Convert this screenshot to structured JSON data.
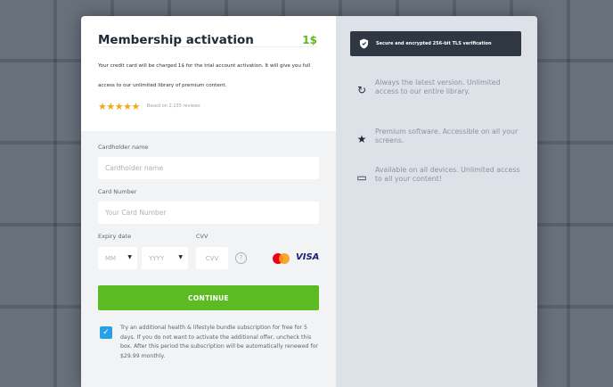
{
  "membership": {
    "title": "Membership activation",
    "price": "1$",
    "description": "Your credit card will be charged 1$ for the trial account activation. It will give you full access to our unlimited library of premium content.",
    "stars": "★★★★★",
    "reviews_text": "Based on 2,135 reviews"
  },
  "form": {
    "cardholder_label": "Cardholder name",
    "cardholder_placeholder": "Cardholder name",
    "cardholder_value": "",
    "card_number_label": "Card Number",
    "card_number_placeholder": "Your Card Number",
    "card_number_value": "",
    "expiry_label": "Expiry date",
    "cvv_label": "CVV",
    "month_selected": "MM",
    "year_selected": "YYYY",
    "cvv_placeholder": "CVV",
    "help_symbol": "?",
    "visa_label": "VISA",
    "continue_label": "CONTINUE",
    "checkbox_mark": "✓",
    "checkbox_checked": true,
    "upsell_text": "Try an additional health & lifestyle bundle subscription for free for 5 days. If you do not want to activate the additional offer, uncheck this box. After this period the subscription will be automatically renewed for $29.99 monthly."
  },
  "sidebar": {
    "tls_text": "Secure and encrypted 256-bit TLS verification",
    "features": [
      {
        "icon": "refresh-icon",
        "glyph": "↻",
        "text": "Always the latest version. Unlimited access to our entire library."
      },
      {
        "icon": "star-icon",
        "glyph": "★",
        "text": "Premium software. Accessible on all your screens."
      },
      {
        "icon": "devices-icon",
        "glyph": "▭",
        "text": "Available on all devices. Unlimited access to all your content!"
      }
    ]
  },
  "colors": {
    "accent_green": "#5cbb22",
    "price_green": "#5cb920",
    "checkbox_blue": "#2b9fe6",
    "star_gold": "#f2a818",
    "banner_dark": "#2f3842"
  }
}
